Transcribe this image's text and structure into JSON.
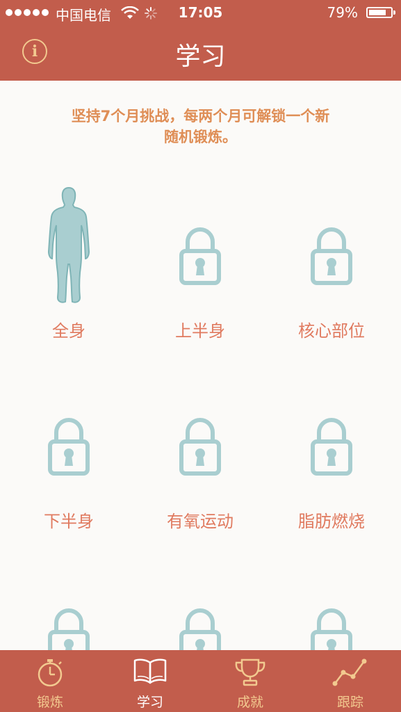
{
  "status_bar": {
    "carrier": "中国电信",
    "time": "17:05",
    "battery_percent": "79%",
    "battery_level": 0.79
  },
  "nav": {
    "title": "学习",
    "info_glyph": "i"
  },
  "intro": {
    "line1": "坚持7个月挑战，每两个月可解锁一个新",
    "line2": "随机锻炼。"
  },
  "workouts": [
    {
      "label": "全身",
      "state": "unlocked",
      "icon": "body-figure-icon"
    },
    {
      "label": "上半身",
      "state": "locked",
      "icon": "lock-icon"
    },
    {
      "label": "核心部位",
      "state": "locked",
      "icon": "lock-icon"
    },
    {
      "label": "下半身",
      "state": "locked",
      "icon": "lock-icon"
    },
    {
      "label": "有氧运动",
      "state": "locked",
      "icon": "lock-icon"
    },
    {
      "label": "脂肪燃烧",
      "state": "locked",
      "icon": "lock-icon"
    },
    {
      "label": "",
      "state": "locked",
      "icon": "lock-icon"
    },
    {
      "label": "",
      "state": "locked",
      "icon": "lock-icon"
    },
    {
      "label": "",
      "state": "locked",
      "icon": "lock-icon"
    }
  ],
  "tabs": [
    {
      "label": "锻炼",
      "icon": "stopwatch-icon",
      "active": false
    },
    {
      "label": "学习",
      "icon": "book-icon",
      "active": true
    },
    {
      "label": "成就",
      "icon": "trophy-icon",
      "active": false
    },
    {
      "label": "跟踪",
      "icon": "chart-line-icon",
      "active": false
    }
  ],
  "colors": {
    "brand": "#c25d4c",
    "accent_text": "#df8e56",
    "label_text": "#e07a5f",
    "icon_teal": "#a9ced0",
    "tab_inactive": "#f2c98f"
  }
}
